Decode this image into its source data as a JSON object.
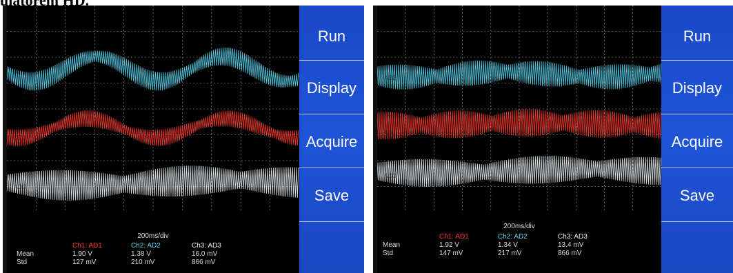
{
  "caption": "ulatorem HD.",
  "screens": [
    {
      "menu": [
        "Run",
        "Display",
        "Acquire",
        "Save"
      ],
      "timebase": "200ms/div",
      "channels": [
        {
          "name": "Ch1: AD1",
          "color": "#ff3b30",
          "mean": "1.90 V",
          "std": "127 mV"
        },
        {
          "name": "Ch2: AD2",
          "color": "#5bd6f0",
          "mean": "1.38 V",
          "std": "210 mV"
        },
        {
          "name": "Ch3: AD3",
          "color": "#e8eef2",
          "mean": "16.0 mV",
          "std": "866 mV"
        }
      ],
      "row_labels": {
        "mean": "Mean",
        "std": "Std"
      },
      "trace_labels": [
        "AD2",
        "AD1",
        "AD3"
      ]
    },
    {
      "menu": [
        "Run",
        "Display",
        "Acquire",
        "Save"
      ],
      "timebase": "200ms/div",
      "channels": [
        {
          "name": "Ch1: AD1",
          "color": "#ff3b30",
          "mean": "1.92 V",
          "std": "147 mV"
        },
        {
          "name": "Ch2: AD2",
          "color": "#5bd6f0",
          "mean": "1.34 V",
          "std": "217 mV"
        },
        {
          "name": "Ch3: AD3",
          "color": "#e8eef2",
          "mean": "13.4 mV",
          "std": "866 mV"
        }
      ],
      "row_labels": {
        "mean": "Mean",
        "std": "Std"
      },
      "trace_labels": [
        "AD2",
        "AD1",
        "AD3"
      ]
    }
  ],
  "colors": {
    "menu_blue": "#1f54d8",
    "grid": "#c9d2dc",
    "screen_bg": "#000000"
  }
}
